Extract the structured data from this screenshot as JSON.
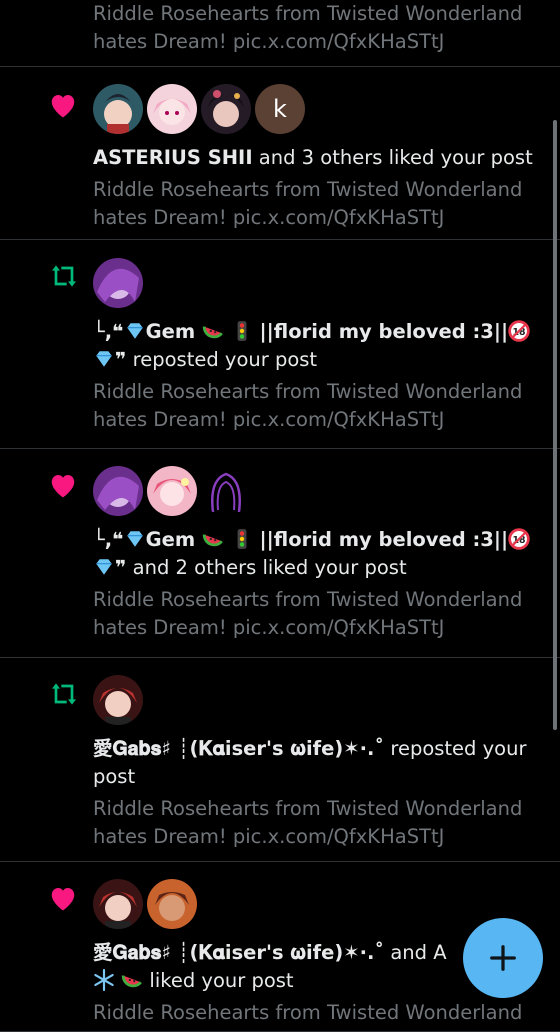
{
  "notifications": [
    {
      "type": "like",
      "headline_bold": "",
      "headline_rest": "",
      "preview": "Riddle Rosehearts from Twisted Wonderland hates Dream! pic.x.com/QfxKHaSTtJ"
    },
    {
      "type": "like",
      "avatar_letter": "k",
      "headline_bold": "ASTERIUS SHII",
      "headline_rest": " and 3 others liked your post",
      "preview": "Riddle Rosehearts from Twisted Wonderland hates Dream! pic.x.com/QfxKHaSTtJ"
    },
    {
      "type": "repost",
      "name_prefix": "└,❝",
      "name_main": "Gem",
      "name_suffix": "||florid my beloved :3||",
      "name_end": "❞",
      "headline_rest": " reposted your post",
      "preview": "Riddle Rosehearts from Twisted Wonderland hates Dream! pic.x.com/QfxKHaSTtJ"
    },
    {
      "type": "like",
      "name_prefix": "└,❝",
      "name_main": "Gem",
      "name_suffix": "||florid my beloved :3||",
      "name_end": "❞",
      "headline_rest": " and 2 others liked your post",
      "preview": "Riddle Rosehearts from Twisted Wonderland hates Dream! pic.x.com/QfxKHaSTtJ"
    },
    {
      "type": "repost",
      "name_main": "愛𝐆𝐚𝐛𝐬♯ ┊(𝐊𝛂iser's 𝛚ife)✶⋅.˚",
      "headline_rest": " reposted your post",
      "preview": "Riddle Rosehearts from Twisted Wonderland hates Dream! pic.x.com/QfxKHaSTtJ"
    },
    {
      "type": "like",
      "name_main": "愛𝐆𝐚𝐛𝐬♯ ┊(𝐊𝛂iser's 𝛚ife)✶⋅.˚",
      "headline_rest": " and A",
      "line2_rest": " liked your post",
      "preview": "Riddle Rosehearts from Twisted Wonderland"
    }
  ],
  "colors": {
    "like": "#f91880",
    "repost": "#00ba7c",
    "fab": "#58b7f3",
    "muted": "#71767b"
  },
  "fab_icon": "plus-icon"
}
